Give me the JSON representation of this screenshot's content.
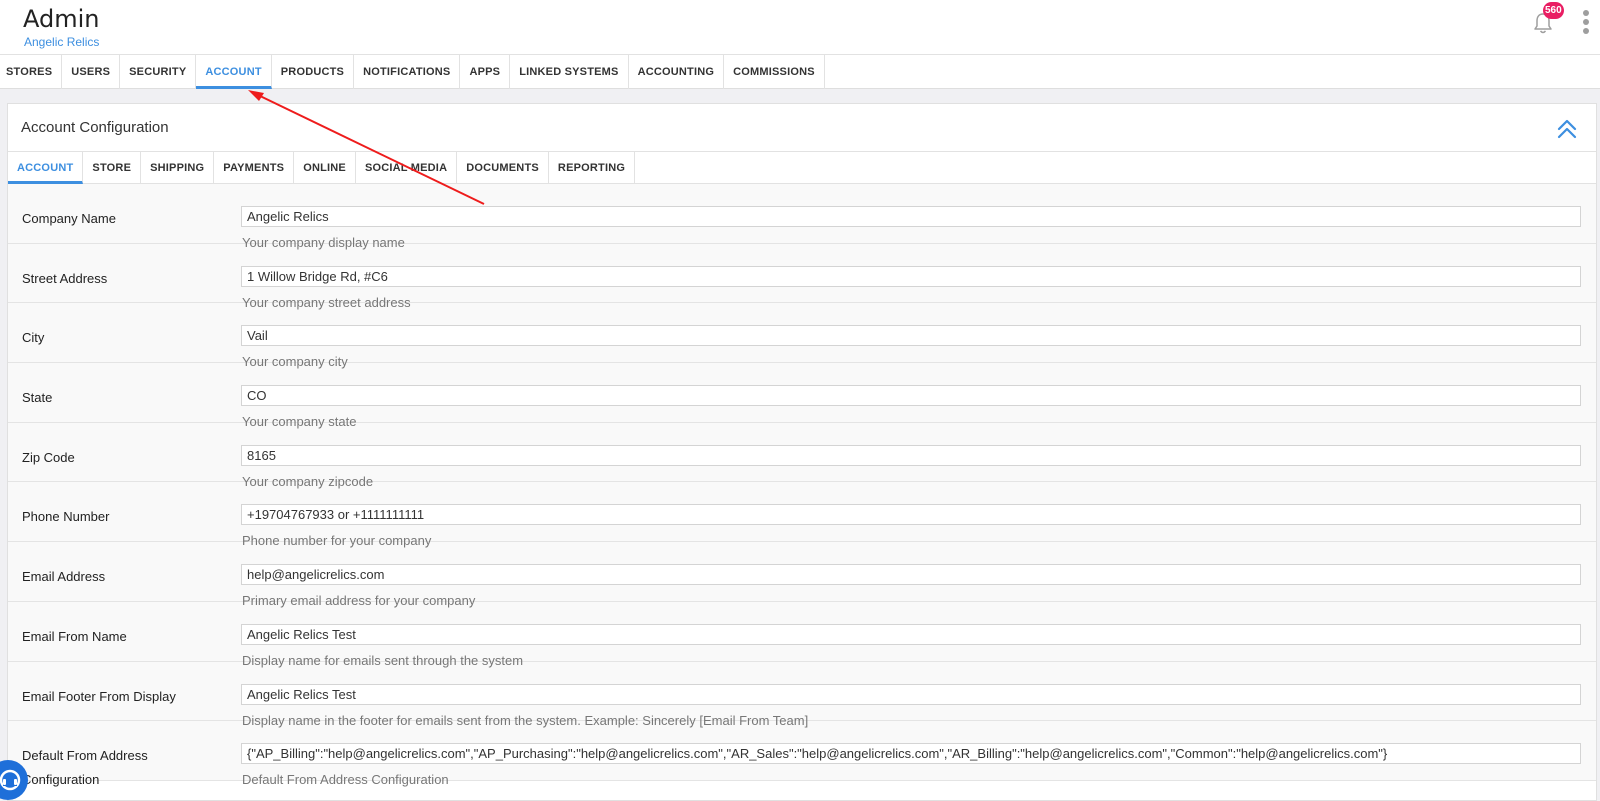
{
  "header": {
    "title": "Admin",
    "subtitle": "Angelic Relics",
    "notification_count": "560"
  },
  "topnav": {
    "tabs": [
      {
        "label": "STORES"
      },
      {
        "label": "USERS"
      },
      {
        "label": "SECURITY"
      },
      {
        "label": "ACCOUNT"
      },
      {
        "label": "PRODUCTS"
      },
      {
        "label": "NOTIFICATIONS"
      },
      {
        "label": "APPS"
      },
      {
        "label": "LINKED SYSTEMS"
      },
      {
        "label": "ACCOUNTING"
      },
      {
        "label": "COMMISSIONS"
      }
    ],
    "active": "ACCOUNT"
  },
  "panel": {
    "title": "Account Configuration",
    "tabs": [
      {
        "label": "ACCOUNT"
      },
      {
        "label": "STORE"
      },
      {
        "label": "SHIPPING"
      },
      {
        "label": "PAYMENTS"
      },
      {
        "label": "ONLINE"
      },
      {
        "label": "SOCIAL MEDIA"
      },
      {
        "label": "DOCUMENTS"
      },
      {
        "label": "REPORTING"
      }
    ],
    "active": "ACCOUNT"
  },
  "form": {
    "fields": [
      {
        "label": "Company Name",
        "value": "Angelic Relics",
        "help": "Your company display name"
      },
      {
        "label": "Street Address",
        "value": "1 Willow Bridge Rd, #C6",
        "help": "Your company street address"
      },
      {
        "label": "City",
        "value": "Vail",
        "help": "Your company city"
      },
      {
        "label": "State",
        "value": "CO",
        "help": "Your company state"
      },
      {
        "label": "Zip Code",
        "value": "8165",
        "help": "Your company zipcode"
      },
      {
        "label": "Phone Number",
        "value": "+19704767933 or +1111111111",
        "help": "Phone number for your company"
      },
      {
        "label": "Email Address",
        "value": "help@angelicrelics.com",
        "help": "Primary email address for your company"
      },
      {
        "label": "Email From Name",
        "value": "Angelic Relics Test",
        "help": "Display name for emails sent through the system"
      },
      {
        "label": "Email Footer From Display",
        "value": "Angelic Relics Test",
        "help": "Display name in the footer for emails sent from the system. Example: Sincerely [Email From Team]"
      },
      {
        "label": "Default From Address",
        "label2": "Configuration",
        "value": "{\"AP_Billing\":\"help@angelicrelics.com\",\"AP_Purchasing\":\"help@angelicrelics.com\",\"AR_Sales\":\"help@angelicrelics.com\",\"AR_Billing\":\"help@angelicrelics.com\",\"Common\":\"help@angelicrelics.com\"}",
        "help": "Default From Address Configuration"
      }
    ]
  },
  "colors": {
    "accent": "#3d8fe0",
    "badge": "#e91e63",
    "annotation_arrow": "#ee1c1c",
    "support_button": "#1e6fd9"
  },
  "icons": {
    "notifications": "bell-icon",
    "menu": "kebab-menu-icon",
    "collapse": "double-chevron-up-icon",
    "support": "support-chat-icon"
  }
}
